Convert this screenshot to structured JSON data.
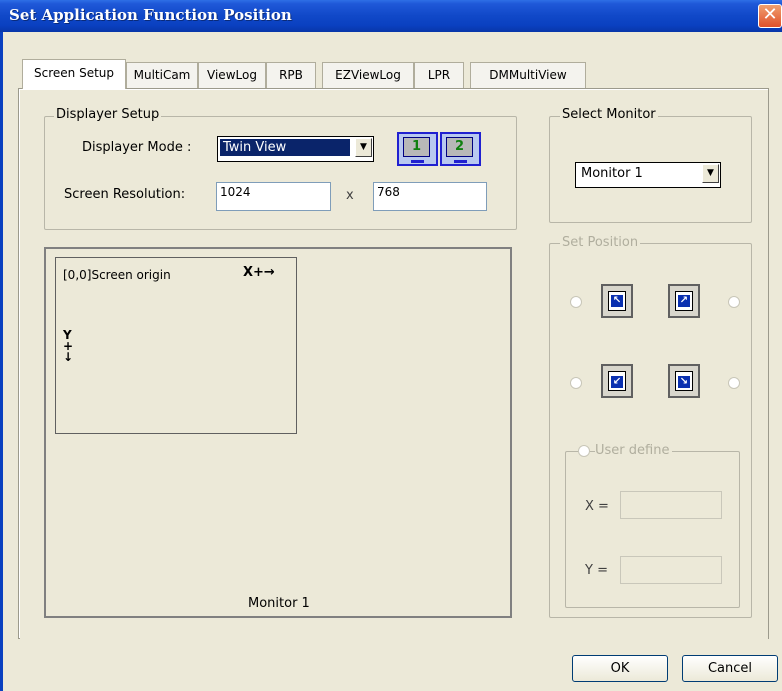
{
  "window": {
    "title": "Set Application Function Position",
    "close_symbol": "✕"
  },
  "tabs": [
    {
      "label": "Screen Setup",
      "active": true
    },
    {
      "label": "MultiCam"
    },
    {
      "label": "ViewLog"
    },
    {
      "label": "RPB"
    },
    {
      "label": "EZViewLog"
    },
    {
      "label": "LPR"
    },
    {
      "label": "DMMultiView"
    }
  ],
  "displayer_setup": {
    "title": "Displayer Setup",
    "mode_label": "Displayer Mode :",
    "mode_value": "Twin View",
    "resolution_label": "Screen Resolution:",
    "resolution_width": "1024",
    "resolution_x": "x",
    "resolution_height": "768",
    "monitor_1": "1",
    "monitor_2": "2"
  },
  "preview": {
    "origin_label": "[0,0]Screen origin",
    "x_axis": "X+→",
    "y_axis": "Y+↓",
    "monitor_label": "Monitor 1"
  },
  "select_monitor": {
    "title": "Select Monitor",
    "value": "Monitor 1"
  },
  "set_position": {
    "title": "Set Position",
    "user_define_label": "User define",
    "x_label": "X =",
    "y_label": "Y ="
  },
  "buttons": {
    "ok": "OK",
    "cancel": "Cancel"
  }
}
